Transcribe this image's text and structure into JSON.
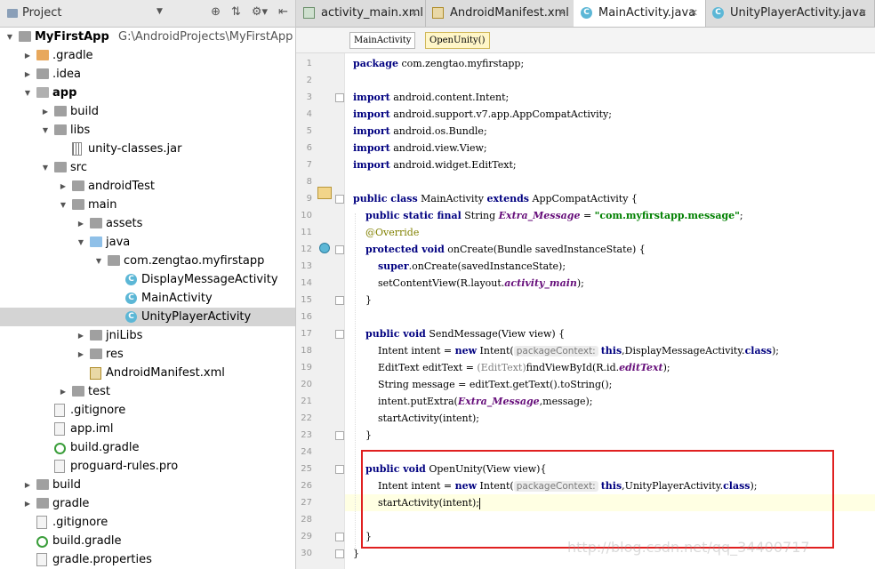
{
  "project_panel": {
    "title": "Project",
    "tree": [
      {
        "label": "MyFirstApp",
        "path": "G:\\AndroidProjects\\MyFirstApp",
        "bold": true,
        "icon": "folder-icon",
        "arrow": "down"
      },
      {
        "label": ".gradle",
        "icon": "folder-icon",
        "arrow": "right"
      },
      {
        "label": ".idea",
        "icon": "folder-icon",
        "arrow": "right"
      },
      {
        "label": "app",
        "bold": true,
        "icon": "module-folder-icon",
        "arrow": "down"
      },
      {
        "label": "build",
        "icon": "folder-icon",
        "arrow": "right"
      },
      {
        "label": "libs",
        "icon": "folder-icon",
        "arrow": "down"
      },
      {
        "label": "unity-classes.jar",
        "icon": "jar-icon"
      },
      {
        "label": "src",
        "icon": "folder-icon",
        "arrow": "down"
      },
      {
        "label": "androidTest",
        "icon": "folder-icon",
        "arrow": "right"
      },
      {
        "label": "main",
        "icon": "folder-icon",
        "arrow": "down"
      },
      {
        "label": "assets",
        "icon": "folder-icon",
        "arrow": "right"
      },
      {
        "label": "java",
        "icon": "source-folder-icon",
        "arrow": "down"
      },
      {
        "label": "com.zengtao.myfirstapp",
        "icon": "package-icon",
        "arrow": "down"
      },
      {
        "label": "DisplayMessageActivity",
        "icon": "class-icon"
      },
      {
        "label": "MainActivity",
        "icon": "class-icon"
      },
      {
        "label": "UnityPlayerActivity",
        "icon": "class-icon",
        "selected": true
      },
      {
        "label": "jniLibs",
        "icon": "folder-icon",
        "arrow": "right"
      },
      {
        "label": "res",
        "icon": "folder-icon",
        "arrow": "right"
      },
      {
        "label": "AndroidManifest.xml",
        "icon": "manifest-icon"
      },
      {
        "label": "test",
        "icon": "folder-icon",
        "arrow": "right"
      },
      {
        "label": ".gitignore",
        "icon": "file-icon"
      },
      {
        "label": "app.iml",
        "icon": "file-icon"
      },
      {
        "label": "build.gradle",
        "icon": "gradle-icon"
      },
      {
        "label": "proguard-rules.pro",
        "icon": "file-icon"
      },
      {
        "label": "build",
        "icon": "folder-icon",
        "arrow": "right"
      },
      {
        "label": "gradle",
        "icon": "folder-icon",
        "arrow": "right"
      },
      {
        "label": ".gitignore",
        "icon": "file-icon"
      },
      {
        "label": "build.gradle",
        "icon": "gradle-icon"
      },
      {
        "label": "gradle.properties",
        "icon": "file-icon"
      }
    ]
  },
  "editor": {
    "tabs": [
      {
        "label": "activity_main.xml",
        "icon": "layout-xml-icon",
        "active": false
      },
      {
        "label": "AndroidManifest.xml",
        "icon": "manifest-icon",
        "active": false
      },
      {
        "label": "MainActivity.java",
        "icon": "class-icon",
        "active": true
      },
      {
        "label": "UnityPlayerActivity.java",
        "icon": "class-icon",
        "active": false
      }
    ],
    "breadcrumbs": [
      "MainActivity",
      "OpenUnity()"
    ],
    "current_line": 27,
    "code_lines": [
      [
        {
          "t": "package",
          "c": "kw"
        },
        {
          "t": " com.zengtao.myfirstapp;"
        }
      ],
      [],
      [
        {
          "t": "import",
          "c": "kw"
        },
        {
          "t": " android.content.Intent;"
        }
      ],
      [
        {
          "t": "import",
          "c": "kw"
        },
        {
          "t": " android.support.v7.app.AppCompatActivity;"
        }
      ],
      [
        {
          "t": "import",
          "c": "kw"
        },
        {
          "t": " android.os.Bundle;"
        }
      ],
      [
        {
          "t": "import",
          "c": "kw"
        },
        {
          "t": " android.view.View;"
        }
      ],
      [
        {
          "t": "import",
          "c": "kw"
        },
        {
          "t": " android.widget.EditText;"
        }
      ],
      [],
      [
        {
          "t": "public class",
          "c": "kw"
        },
        {
          "t": " MainActivity "
        },
        {
          "t": "extends",
          "c": "kw"
        },
        {
          "t": " AppCompatActivity {"
        }
      ],
      [
        {
          "t": "    "
        },
        {
          "t": "public static final",
          "c": "kw"
        },
        {
          "t": " String "
        },
        {
          "t": "Extra_Message",
          "c": "fld"
        },
        {
          "t": " = "
        },
        {
          "t": "\"com.myfirstapp.message\"",
          "c": "str"
        },
        {
          "t": ";"
        }
      ],
      [
        {
          "t": "    "
        },
        {
          "t": "@Override",
          "c": "ann"
        }
      ],
      [
        {
          "t": "    "
        },
        {
          "t": "protected void",
          "c": "kw"
        },
        {
          "t": " onCreate(Bundle savedInstanceState) {"
        }
      ],
      [
        {
          "t": "        "
        },
        {
          "t": "super",
          "c": "kw"
        },
        {
          "t": ".onCreate(savedInstanceState);"
        }
      ],
      [
        {
          "t": "        setContentView(R.layout."
        },
        {
          "t": "activity_main",
          "c": "fld"
        },
        {
          "t": ");"
        }
      ],
      [
        {
          "t": "    }"
        }
      ],
      [],
      [
        {
          "t": "    "
        },
        {
          "t": "public void",
          "c": "kw"
        },
        {
          "t": " SendMessage(View view) {"
        }
      ],
      [
        {
          "t": "        Intent intent = "
        },
        {
          "t": "new",
          "c": "kw"
        },
        {
          "t": " Intent("
        },
        {
          "t": "packageContext:",
          "c": "hint"
        },
        {
          "t": "this",
          "c": "kw"
        },
        {
          "t": ",DisplayMessageActivity."
        },
        {
          "t": "class",
          "c": "kw"
        },
        {
          "t": ");"
        }
      ],
      [
        {
          "t": "        EditText editText = "
        },
        {
          "t": "(EditText)",
          "c": "cast"
        },
        {
          "t": "findViewById(R.id."
        },
        {
          "t": "editText",
          "c": "fld"
        },
        {
          "t": ");"
        }
      ],
      [
        {
          "t": "        String message = editText.getText().toString();"
        }
      ],
      [
        {
          "t": "        intent.putExtra("
        },
        {
          "t": "Extra_Message",
          "c": "fld"
        },
        {
          "t": ",message);"
        }
      ],
      [
        {
          "t": "        startActivity(intent);"
        }
      ],
      [
        {
          "t": "    }"
        }
      ],
      [],
      [
        {
          "t": "    "
        },
        {
          "t": "public void",
          "c": "kw"
        },
        {
          "t": " OpenUnity(View view){"
        }
      ],
      [
        {
          "t": "        Intent intent = "
        },
        {
          "t": "new",
          "c": "kw"
        },
        {
          "t": " Intent("
        },
        {
          "t": "packageContext:",
          "c": "hint"
        },
        {
          "t": "this",
          "c": "kw"
        },
        {
          "t": ",UnityPlayerActivity."
        },
        {
          "t": "class",
          "c": "kw"
        },
        {
          "t": ");"
        }
      ],
      [
        {
          "t": "        startActivity(intent);"
        }
      ],
      [],
      [
        {
          "t": "    }"
        }
      ],
      [
        {
          "t": "}"
        }
      ]
    ]
  },
  "watermark": "http://blog.csdn.net/qq_34400717"
}
